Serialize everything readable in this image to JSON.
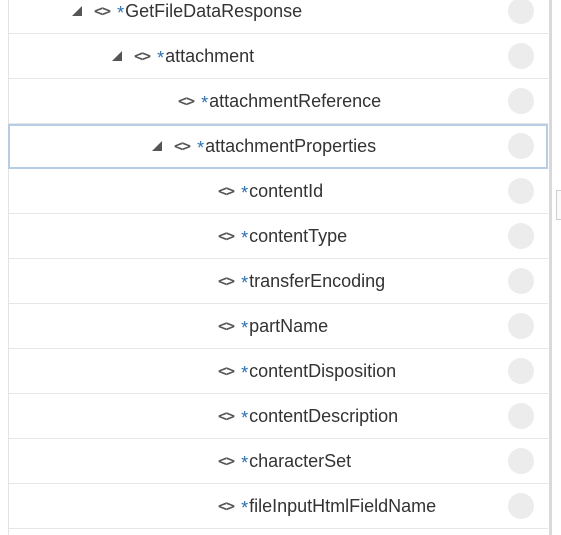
{
  "icons": {
    "expander": "collapse-triangle-icon",
    "element": "element-brackets-icon",
    "element_glyph": "<>",
    "required_marker": "*",
    "status": "status-dot-icon"
  },
  "colors": {
    "required": "#2a6fb0",
    "selected_outline": "#b7cde4",
    "text": "#333333",
    "row_border": "#e6e6e6",
    "status_dot": "#ececec"
  },
  "tree": {
    "rows": [
      {
        "label": "GetFileDataResponse",
        "expanded": true
      },
      {
        "label": "attachment",
        "expanded": true
      },
      {
        "label": "attachmentReference",
        "expanded": null
      },
      {
        "label": "attachmentProperties",
        "expanded": true,
        "selected": true
      },
      {
        "label": "contentId",
        "expanded": null
      },
      {
        "label": "contentType",
        "expanded": null
      },
      {
        "label": "transferEncoding",
        "expanded": null
      },
      {
        "label": "partName",
        "expanded": null
      },
      {
        "label": "contentDisposition",
        "expanded": null
      },
      {
        "label": "contentDescription",
        "expanded": null
      },
      {
        "label": "characterSet",
        "expanded": null
      },
      {
        "label": "fileInputHtmlFieldName",
        "expanded": null
      }
    ]
  }
}
